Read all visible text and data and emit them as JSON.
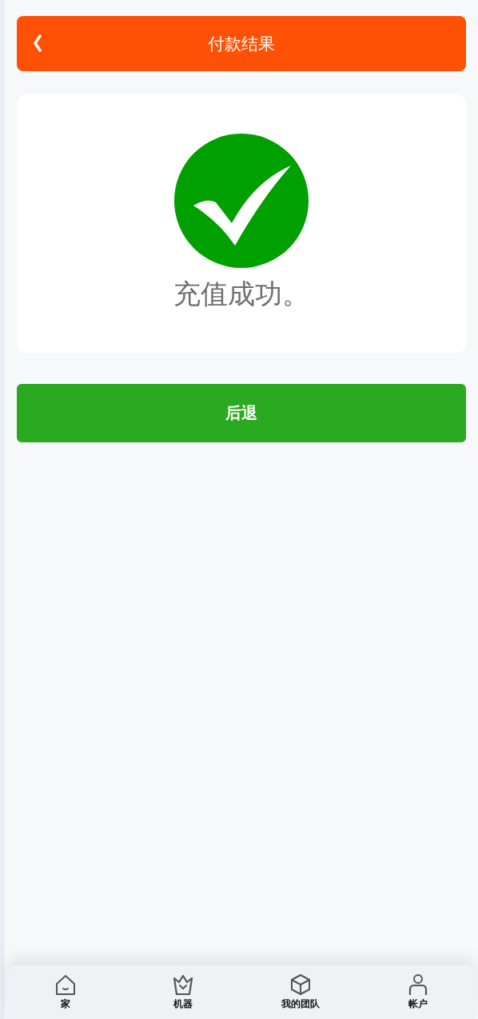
{
  "header": {
    "title": "付款结果"
  },
  "result": {
    "message": "充值成功。"
  },
  "back_button": {
    "label": "后退"
  },
  "bottom_nav": [
    {
      "label": "家"
    },
    {
      "label": "机器"
    },
    {
      "label": "我的团队"
    },
    {
      "label": "帐户"
    }
  ]
}
